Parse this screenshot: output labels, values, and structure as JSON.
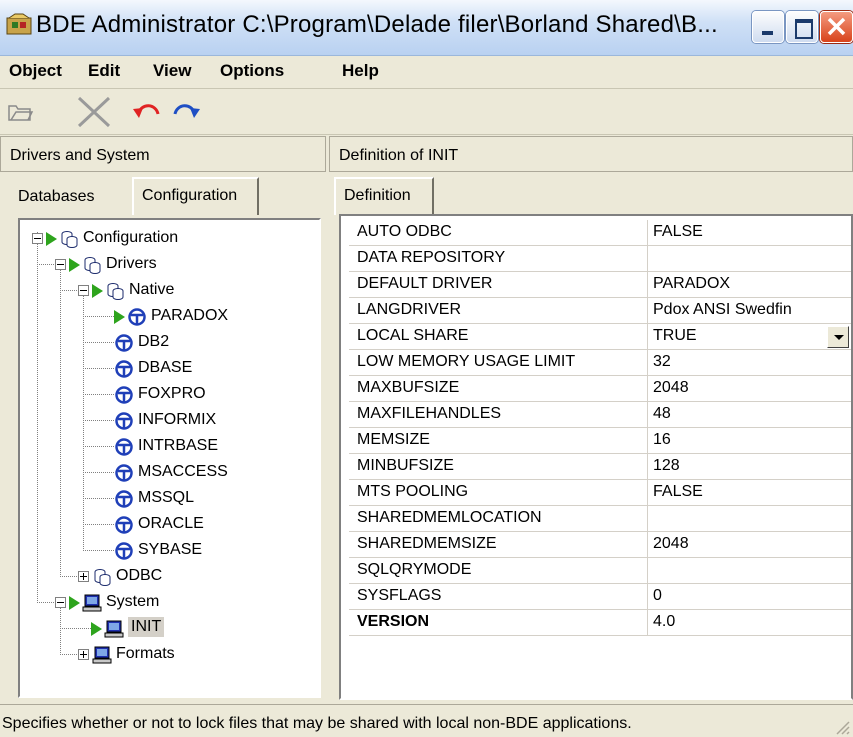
{
  "window": {
    "title": "BDE Administrator  C:\\Program\\Delade filer\\Borland Shared\\B..."
  },
  "menu": [
    {
      "label": "Object"
    },
    {
      "label": "Edit"
    },
    {
      "label": "View"
    },
    {
      "label": "Options"
    },
    {
      "label": "Help"
    }
  ],
  "toolbar": {
    "icons": [
      "open-folder-icon",
      "delete-icon",
      "undo-icon",
      "redo-icon"
    ]
  },
  "left_panel": {
    "header": "Drivers and System",
    "tabs": [
      {
        "label": "Databases",
        "active": false
      },
      {
        "label": "Configuration",
        "active": true
      }
    ],
    "tree": [
      {
        "label": "Configuration"
      },
      {
        "label": "Drivers"
      },
      {
        "label": "Native"
      },
      {
        "label": "PARADOX"
      },
      {
        "label": "DB2"
      },
      {
        "label": "DBASE"
      },
      {
        "label": "FOXPRO"
      },
      {
        "label": "INFORMIX"
      },
      {
        "label": "INTRBASE"
      },
      {
        "label": "MSACCESS"
      },
      {
        "label": "MSSQL"
      },
      {
        "label": "ORACLE"
      },
      {
        "label": "SYBASE"
      },
      {
        "label": "ODBC"
      },
      {
        "label": "System"
      },
      {
        "label": "INIT"
      },
      {
        "label": "Formats"
      }
    ]
  },
  "right_panel": {
    "header": "Definition of INIT",
    "tab": "Definition",
    "rows": [
      {
        "name": "AUTO ODBC",
        "value": "FALSE"
      },
      {
        "name": "DATA REPOSITORY",
        "value": ""
      },
      {
        "name": "DEFAULT DRIVER",
        "value": "PARADOX"
      },
      {
        "name": "LANGDRIVER",
        "value": "Pdox ANSI Swedfin"
      },
      {
        "name": "LOCAL SHARE",
        "value": "TRUE"
      },
      {
        "name": "LOW MEMORY USAGE LIMIT",
        "value": "32"
      },
      {
        "name": "MAXBUFSIZE",
        "value": "2048"
      },
      {
        "name": "MAXFILEHANDLES",
        "value": "48"
      },
      {
        "name": "MEMSIZE",
        "value": "16"
      },
      {
        "name": "MINBUFSIZE",
        "value": "128"
      },
      {
        "name": "MTS POOLING",
        "value": "FALSE"
      },
      {
        "name": "SHAREDMEMLOCATION",
        "value": ""
      },
      {
        "name": "SHAREDMEMSIZE",
        "value": "2048"
      },
      {
        "name": "SQLQRYMODE",
        "value": ""
      },
      {
        "name": "SYSFLAGS",
        "value": "0"
      },
      {
        "name": "VERSION",
        "value": "4.0"
      }
    ]
  },
  "status": {
    "text": "Specifies whether or not to lock files that may be shared with local non-BDE applications."
  },
  "colors": {
    "arrow_green": "#2ea41d",
    "driver_blue": "#1f3fb8",
    "window_bg": "#ece9d8",
    "title_gradient_top": "#f4f8fd",
    "close_red": "#d8431b"
  }
}
